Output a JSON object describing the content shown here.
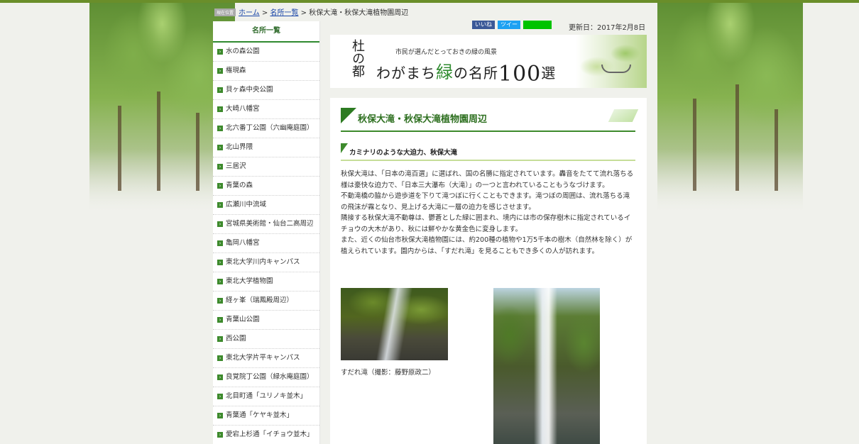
{
  "breadcrumb": {
    "location_label": "現在位置",
    "home": "ホーム",
    "sep1": " > ",
    "list": "名所一覧",
    "sep2": " > ",
    "current": "秋保大滝・秋保大滝植物園周辺"
  },
  "share": {
    "facebook": "いいね",
    "twitter": "ツイー",
    "line": ""
  },
  "updated": "更新日：2017年2月8日",
  "banner": {
    "logo": "杜の都",
    "subtitle": "市民が選んだとっておきの緑の風景",
    "title_part1": "わがまち",
    "title_green": "緑",
    "title_part2": "の名所",
    "title_num": "100",
    "title_suffix": "選"
  },
  "sidebar": {
    "heading": "名所一覧",
    "items": [
      "水の森公園",
      "権現森",
      "貝ヶ森中央公園",
      "大崎八幡宮",
      "北六番丁公園（六幽庵庭園）",
      "北山界隈",
      "三居沢",
      "青葉の森",
      "広瀬川中流域",
      "宮城県美術館・仙台二高周辺",
      "亀岡八幡宮",
      "東北大学川内キャンパス",
      "東北大学植物園",
      "経ヶ峯（瑞鳳殿周辺）",
      "青葉山公園",
      "西公園",
      "東北大学片平キャンパス",
      "良覚院丁公園（緑水庵庭園）",
      "北目町通「ユリノキ並木」",
      "青葉通「ケヤキ並木」",
      "愛宕上杉通「イチョウ並木」"
    ]
  },
  "content": {
    "title": "秋保大滝・秋保大滝植物園周辺",
    "subtitle": "カミナリのような大迫力、秋保大滝",
    "paragraphs": [
      "秋保大滝は、「日本の滝百選」に選ばれ、国の名勝に指定されています。轟音をたてて流れ落ちる様は豪快な迫力で、「日本三大瀑布（大滝）」の一つと言われていることもうなづけます。",
      "不動滝橋の脇から遊歩道を下りて滝つぼに行くこともできます。滝つぼの周囲は、流れ落ちる滝の飛沫が霧となり、見上げる大滝に一層の迫力を感じさせます。",
      "隣接する秋保大滝不動尊は、鬱蒼とした緑に囲まれ、境内には市の保存樹木に指定されているイチョウの大木があり、秋には鮮やかな黄金色に変身します。",
      "また、近くの仙台市秋保大滝植物園には、約200種の植物や1万5千本の樹木（自然林を除く）が植えられています。園内からは、「すだれ滝」を見ることもでき多くの人が訪れます。"
    ],
    "caption1": "すだれ滝（撮影：藤野原政二）"
  },
  "colors": {
    "accent_green": "#3d8a2c",
    "top_bar": "#6a8e2a",
    "link_blue": "#1a46a8",
    "page_bg": "#f0f1ec"
  }
}
